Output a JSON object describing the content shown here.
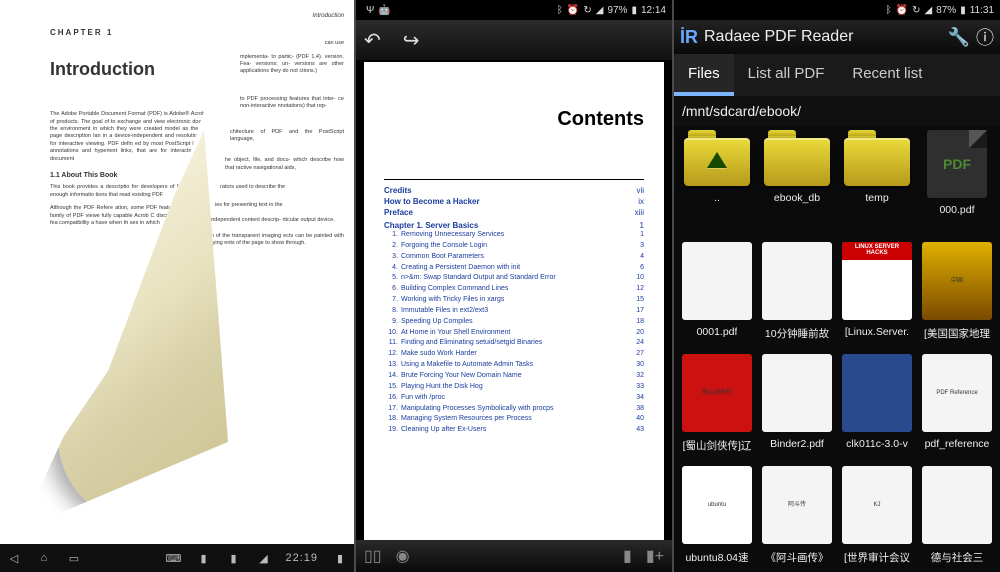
{
  "left": {
    "header_right": "Introduction",
    "under_p1": "can use",
    "under_p2": "mplementa- to partic- (PDF 1.4). version. Fea- versions; un- versions are other applications they do not ctions.)",
    "under_p3": "to PDF processing features that inter- ce non-interactive nnotations) that rep-",
    "under_p4": "chitecture of PDF and the PostScript language,",
    "under_p5": "he object, file, and docu- which describe how that ractive navigational aids,",
    "under_p6": "rators used to describe the",
    "under_p7": "ies for presenting text in the",
    "under_p8": "independent content descrip- rticular output device.",
    "under_p9": "tion of the transparent imaging ects can be painted with varying ents of the page to show through.",
    "chapter_label": "CHAPTER 1",
    "title": "Introduction",
    "p1": "The Adobe Portable Document Format (PDF) is Adobe® Acrobat® family of products. The goal of to exchange and view electronic documents eas the environment in which they were created model as the PostScript® page description lan in a device-independent and resolution-inde matter for interactive viewing. PDF defin ed by most PostScript language progr annotations and hypertext links, that are for interactive viewing and document",
    "sec11": "1.1  About This Book",
    "p2": "This book provides a descriptio for developers of PDF produc contains enough informatio tions that read existing PDF",
    "p3": "Although the PDF Refere ation, some PDF featu scribed by a typical ap family of PDF viewe fully capable Acrob C discusses some though these fea compatibility a have when th ses in which",
    "navbar_time": "22:19"
  },
  "mid": {
    "status_battery": "97%",
    "status_time": "12:14",
    "contents_title": "Contents",
    "heads": [
      {
        "label": "Credits",
        "pg": "vii"
      },
      {
        "label": "How to Become a Hacker",
        "pg": "ix"
      },
      {
        "label": "Preface",
        "pg": "xiii"
      }
    ],
    "chapter": {
      "label": "Chapter 1.  Server Basics",
      "pg": "1"
    },
    "rows": [
      {
        "n": "1",
        "label": "Removing Unnecessary Services",
        "pg": "1"
      },
      {
        "n": "2",
        "label": "Forgoing the Console Login",
        "pg": "3"
      },
      {
        "n": "3",
        "label": "Common Boot Parameters",
        "pg": "4"
      },
      {
        "n": "4",
        "label": "Creating a Persistent Daemon with init",
        "pg": "6"
      },
      {
        "n": "5",
        "label": "n>&m: Swap Standard Output and Standard Error",
        "pg": "10"
      },
      {
        "n": "6",
        "label": "Building Complex Command Lines",
        "pg": "12"
      },
      {
        "n": "7",
        "label": "Working with Tricky Files in xargs",
        "pg": "15"
      },
      {
        "n": "8",
        "label": "Immutable Files in ext2/ext3",
        "pg": "17"
      },
      {
        "n": "9",
        "label": "Speeding Up Compiles",
        "pg": "18"
      },
      {
        "n": "10",
        "label": "At Home in Your Shell Environment",
        "pg": "20"
      },
      {
        "n": "11",
        "label": "Finding and Eliminating setuid/setgid Binaries",
        "pg": "24"
      },
      {
        "n": "12",
        "label": "Make sudo Work Harder",
        "pg": "27"
      },
      {
        "n": "13",
        "label": "Using a Makefile to Automate Admin Tasks",
        "pg": "30"
      },
      {
        "n": "14",
        "label": "Brute Forcing Your New Domain Name",
        "pg": "32"
      },
      {
        "n": "15",
        "label": "Playing Hunt the Disk Hog",
        "pg": "33"
      },
      {
        "n": "16",
        "label": "Fun with /proc",
        "pg": "34"
      },
      {
        "n": "17",
        "label": "Manipulating Processes Symbolically with procps",
        "pg": "38"
      },
      {
        "n": "18",
        "label": "Managing System Resources per Process",
        "pg": "40"
      },
      {
        "n": "19",
        "label": "Cleaning Up after Ex-Users",
        "pg": "43"
      }
    ]
  },
  "right": {
    "status_battery": "87%",
    "status_time": "11:31",
    "app_title": "Radaee PDF Reader",
    "tabs": {
      "files": "Files",
      "list": "List all PDF",
      "recent": "Recent list"
    },
    "path": "/mnt/sdcard/ebook/",
    "items": [
      {
        "kind": "folder-up",
        "label": ".."
      },
      {
        "kind": "folder",
        "label": "ebook_db"
      },
      {
        "kind": "folder",
        "label": "temp"
      },
      {
        "kind": "pdf-icon",
        "label": "000.pdf"
      },
      {
        "kind": "thumb",
        "cls": "th-white",
        "label": "0001.pdf",
        "inner": ""
      },
      {
        "kind": "thumb",
        "cls": "th-white",
        "label": "10分钟睡前故",
        "inner": ""
      },
      {
        "kind": "thumb",
        "cls": "th-linux",
        "label": "[Linux.Server.",
        "inner": "LINUX SERVER HACKS"
      },
      {
        "kind": "thumb",
        "cls": "th-natgeo",
        "label": "[美国国家地理",
        "inner": "中国"
      },
      {
        "kind": "thumb",
        "cls": "th-red",
        "label": "[蜀山剑侠传]辽",
        "inner": "蜀山剑侠传"
      },
      {
        "kind": "thumb",
        "cls": "th-white",
        "label": "Binder2.pdf",
        "inner": ""
      },
      {
        "kind": "thumb",
        "cls": "th-blue",
        "label": "clk011c-3.0-v",
        "inner": ""
      },
      {
        "kind": "thumb",
        "cls": "th-white",
        "label": "pdf_reference",
        "inner": "PDF Reference"
      },
      {
        "kind": "thumb",
        "cls": "th-ubuntu",
        "label": "ubuntu8.04速",
        "inner": "ubuntu"
      },
      {
        "kind": "thumb",
        "cls": "th-white",
        "label": "《阿斗画传》",
        "inner": "阿斗传"
      },
      {
        "kind": "thumb",
        "cls": "th-white",
        "label": "[世界审计会议",
        "inner": "KJ"
      },
      {
        "kind": "thumb",
        "cls": "th-white",
        "label": "德与社会三",
        "inner": ""
      }
    ]
  }
}
